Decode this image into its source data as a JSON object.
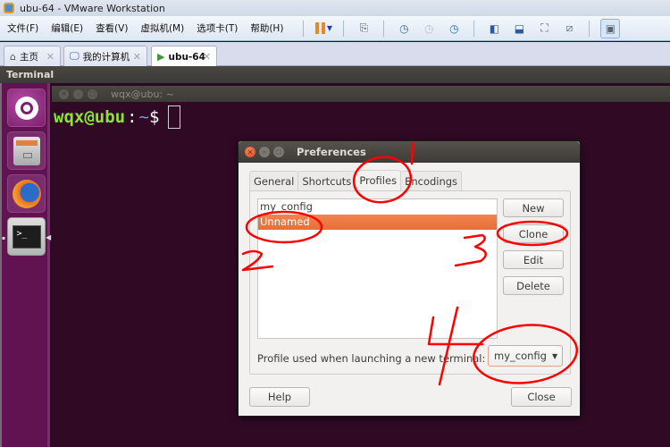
{
  "vmware": {
    "window_title": "ubu-64 - VMware Workstation",
    "menu": [
      "文件(F)",
      "编辑(E)",
      "查看(V)",
      "虚拟机(M)",
      "选项卡(T)",
      "帮助(H)"
    ],
    "toolbar_icons": [
      "pause-icon",
      "dropdown-caret-icon",
      "send-ctrl-alt-del-icon",
      "take-snapshot-icon",
      "revert-snapshot-icon",
      "snapshot-manager-icon",
      "show-library-icon",
      "thumbnail-bar-icon",
      "full-screen-icon",
      "unity-icon",
      "console-view-icon"
    ],
    "tabs": [
      {
        "label": "主页",
        "icon": "home-icon",
        "active": false
      },
      {
        "label": "我的计算机",
        "icon": "computer-icon",
        "active": false
      },
      {
        "label": "ubu-64",
        "icon": "vm-running-icon",
        "active": true
      }
    ],
    "tab_close_glyph": "✕"
  },
  "ubuntu": {
    "panel_title": "Terminal",
    "launcher": [
      {
        "name": "dash",
        "icon": "ubuntu-logo-icon"
      },
      {
        "name": "files",
        "icon": "file-cabinet-icon"
      },
      {
        "name": "firefox",
        "icon": "firefox-icon"
      },
      {
        "name": "terminal",
        "icon": "terminal-icon",
        "glyph": ">_"
      }
    ]
  },
  "terminal": {
    "title": "wqx@ubu: ~",
    "prompt_user": "wqx@ubu",
    "prompt_colon": ":",
    "prompt_path": "~",
    "prompt_symbol": "$"
  },
  "preferences": {
    "title": "Preferences",
    "tabs": [
      {
        "label": "General",
        "active": false
      },
      {
        "label": "Shortcuts",
        "active": false
      },
      {
        "label": "Profiles",
        "active": true
      },
      {
        "label": "Encodings",
        "active": false
      }
    ],
    "profiles": [
      {
        "name": "my_config",
        "selected": false
      },
      {
        "name": "Unnamed",
        "selected": true
      }
    ],
    "buttons": {
      "new": "New",
      "clone": "Clone",
      "edit": "Edit",
      "delete": "Delete",
      "help": "Help",
      "close": "Close"
    },
    "default_profile_label": "Profile used when launching a new terminal:",
    "default_profile_value": "my_config"
  },
  "annotations": {
    "color": "#ff0000",
    "numbers": [
      "1",
      "2",
      "3",
      "4"
    ]
  },
  "colors": {
    "terminal_bg": "#300a24",
    "launcher_bg": "#611351",
    "prompt_user": "#8ae234",
    "prompt_path": "#729fcf",
    "selection": "#e76f38"
  }
}
